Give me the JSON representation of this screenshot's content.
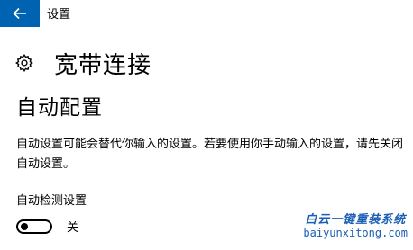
{
  "window": {
    "title": "设置"
  },
  "colors": {
    "accent": "#0063b1",
    "watermark": "#1a5fb4"
  },
  "header": {
    "icon": "gear-icon",
    "title": "宽带连接"
  },
  "section": {
    "title": "自动配置",
    "description": "自动设置可能会替代你输入的设置。若要使用你手动输入的设置，请先关闭自动设置。",
    "setting_label": "自动检测设置",
    "toggle_state": "关",
    "toggle_on": false
  },
  "watermark": {
    "logo_text": "白云一键重装系统",
    "url": "baiyunxitong.com"
  }
}
